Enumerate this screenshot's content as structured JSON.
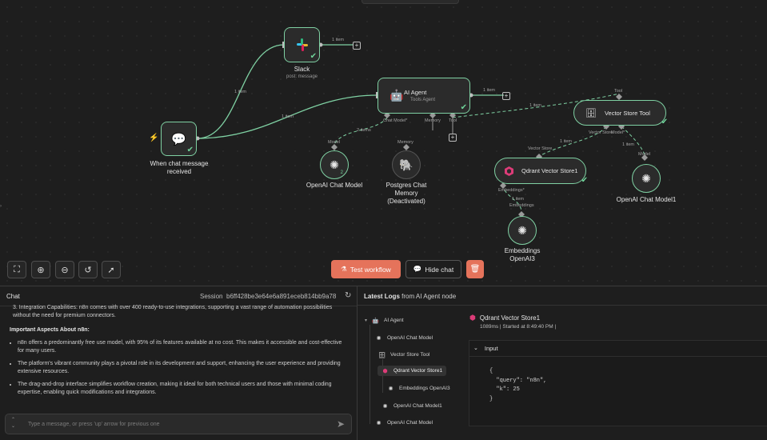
{
  "canvas": {
    "nodes": {
      "slack": {
        "label": "Slack",
        "sub": "post: message"
      },
      "ai_agent": {
        "label": "AI Agent",
        "sub": "Tools Agent",
        "port_chat_model": "Chat Model*",
        "port_memory": "Memory",
        "port_tool": "Tool"
      },
      "trigger": {
        "label": "When chat message received"
      },
      "openai_chat_model": {
        "label": "OpenAI Chat Model",
        "port": "Model",
        "badge": "2"
      },
      "postgres": {
        "label": "Postgres Chat Memory (Deactivated)",
        "port": "Memory"
      },
      "vector_store_tool": {
        "label": "Vector Store Tool",
        "port_top": "Tool",
        "port_vs": "Vector Store",
        "port_model": "Model*"
      },
      "qdrant": {
        "label": "Qdrant Vector Store1",
        "port_top": "Vector Store",
        "port_embeddings": "Embeddings*"
      },
      "openai_chat_model1": {
        "label": "OpenAI Chat Model1",
        "port": "Model"
      },
      "embeddings": {
        "label": "Embeddings OpenAI3",
        "port": "Embeddings"
      }
    },
    "edge_labels": {
      "slack_out": "1 item",
      "trigger_slack": "1 item",
      "trigger_agent": "1 item",
      "agent_out": "1 item",
      "agent_tool": "1 item",
      "model_agent": "2 items",
      "vs_qdrant": "1 item",
      "vs_model1": "1 item",
      "qdrant_embed": "1 item"
    },
    "controls": {
      "test_workflow": "Test workflow",
      "hide_chat": "Hide chat"
    }
  },
  "chat": {
    "title": "Chat",
    "session_label": "Session",
    "session_id": "b6ff428be3e64e6a891eceb814bb9a78",
    "messages": {
      "item3": "3. Integration Capabilities: n8n comes with over 400 ready-to-use integrations, supporting a vast range of automation possibilities without the need for premium connectors.",
      "heading": "Important Aspects About n8n:",
      "bullets": [
        "n8n offers a predominantly free use model, with 95% of its features available at no cost. This makes it accessible and cost-effective for many users.",
        "The platform's vibrant community plays a pivotal role in its development and support, enhancing the user experience and providing extensive resources.",
        "The drag-and-drop interface simplifies workflow creation, making it ideal for both technical users and those with minimal coding expertise, enabling quick modifications and integrations."
      ]
    },
    "input_placeholder": "Type a message, or press 'up' arrow for previous one"
  },
  "logs": {
    "title_bold": "Latest Logs",
    "title_rest": "from AI Agent node",
    "tree": [
      {
        "label": "AI Agent",
        "icon": "robot-icon"
      },
      {
        "label": "OpenAI Chat Model",
        "icon": "openai-icon"
      },
      {
        "label": "Vector Store Tool",
        "icon": "database-icon"
      },
      {
        "label": "Qdrant Vector Store1",
        "icon": "qdrant-icon"
      },
      {
        "label": "Embeddings OpenAI3",
        "icon": "openai-icon"
      },
      {
        "label": "OpenAI Chat Model1",
        "icon": "openai-icon"
      },
      {
        "label": "OpenAI Chat Model",
        "icon": "openai-icon"
      }
    ],
    "detail": {
      "title": "Qdrant Vector Store1",
      "meta": "1089ms | Started at 8:49:40 PM |",
      "section": "Input",
      "code": {
        "open": "{",
        "line1": "  \"query\": \"n8n\",",
        "line2": "  \"k\": 25",
        "close": "}"
      }
    }
  },
  "colors": {
    "accent": "#e5735b",
    "success": "#6fd399",
    "node_border": "#7fd1a3",
    "qdrant": "#dc3c78"
  }
}
